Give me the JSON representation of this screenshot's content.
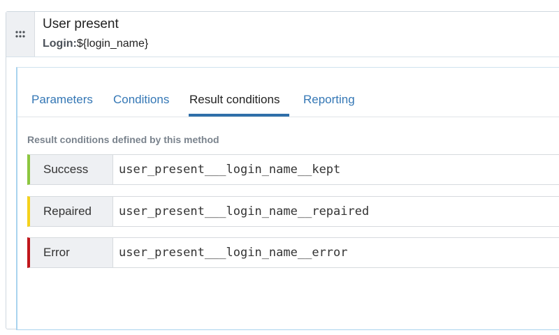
{
  "method": {
    "title": "User present",
    "parameter_name": "Login:",
    "parameter_value": "${login_name}"
  },
  "tabs": [
    {
      "label": "Parameters"
    },
    {
      "label": "Conditions"
    },
    {
      "label": "Result conditions"
    },
    {
      "label": "Reporting"
    }
  ],
  "active_tab": "Result conditions",
  "section_label": "Result conditions defined by this method",
  "result_conditions": [
    {
      "label": "Success",
      "value": "user_present___login_name__kept",
      "color": "#8cc63f"
    },
    {
      "label": "Repaired",
      "value": "user_present___login_name__repaired",
      "color": "#f5d21b"
    },
    {
      "label": "Error",
      "value": "user_present___login_name__error",
      "color": "#c0161b"
    }
  ],
  "colors": {
    "link": "#3477b5",
    "active_tab_underline": "#2f6fa9"
  },
  "icons": {
    "drag_handle": "grip-dots-icon"
  }
}
